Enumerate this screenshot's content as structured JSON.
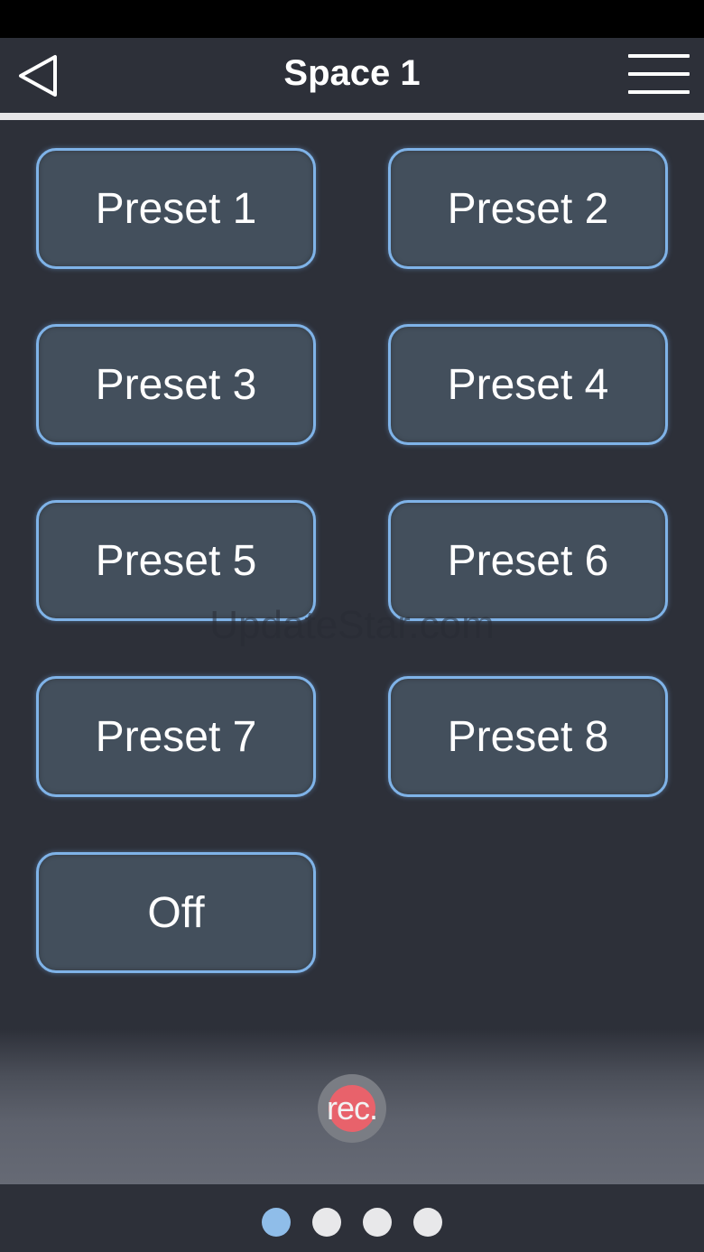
{
  "header": {
    "title": "Space 1",
    "back_icon": "back-triangle-icon",
    "menu_icon": "hamburger-menu-icon"
  },
  "presets": [
    {
      "label": "Preset 1"
    },
    {
      "label": "Preset 2"
    },
    {
      "label": "Preset 3"
    },
    {
      "label": "Preset 4"
    },
    {
      "label": "Preset 5"
    },
    {
      "label": "Preset 6"
    },
    {
      "label": "Preset 7"
    },
    {
      "label": "Preset 8"
    },
    {
      "label": "Off"
    }
  ],
  "watermark": "UpdateStar.com",
  "record": {
    "label": "rec."
  },
  "pager": {
    "pages": 4,
    "active_page": 1
  },
  "colors": {
    "background": "#2d3039",
    "button_fill": "#434f5c",
    "button_border": "#7fb3e8",
    "record_red": "#e8626b",
    "active_dot": "#8fbde9"
  }
}
